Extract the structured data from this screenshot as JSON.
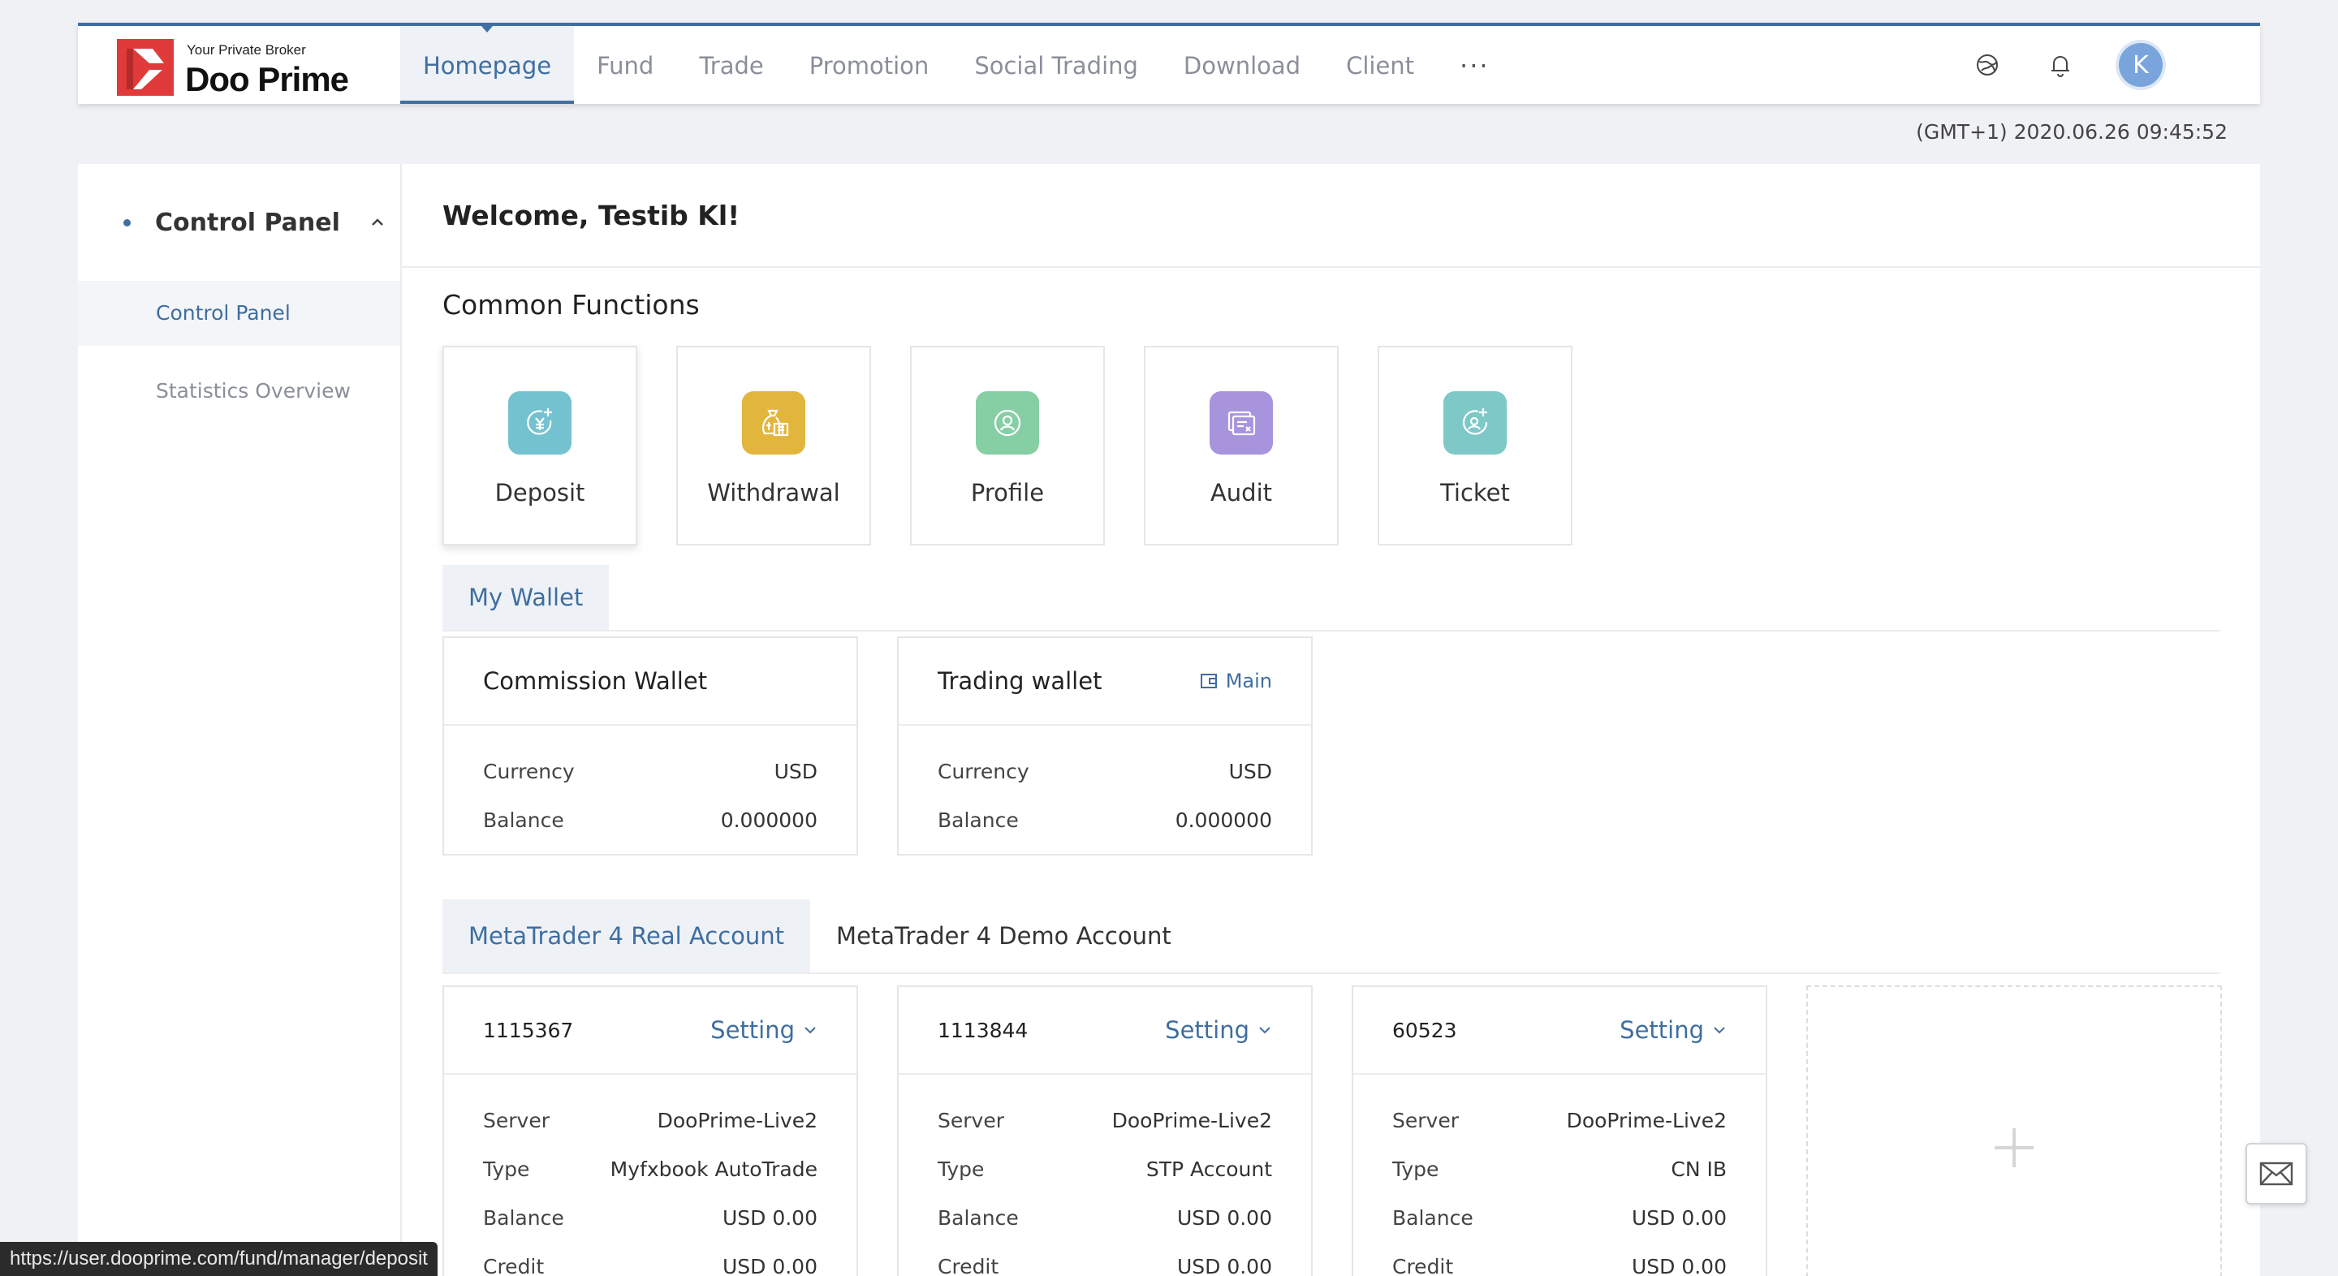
{
  "brand": {
    "tagline": "Your Private Broker",
    "name": "Doo Prime",
    "logo_color": "#e03a3a"
  },
  "nav": {
    "items": [
      {
        "label": "Homepage",
        "active": true
      },
      {
        "label": "Fund"
      },
      {
        "label": "Trade"
      },
      {
        "label": "Promotion"
      },
      {
        "label": "Social Trading"
      },
      {
        "label": "Download"
      },
      {
        "label": "Client"
      }
    ],
    "more_label": "···",
    "icons": [
      "language-icon",
      "bell-icon"
    ],
    "avatar_initial": "K"
  },
  "clock": "(GMT+1) 2020.06.26 09:45:52",
  "sidebar": {
    "group_label": "Control Panel",
    "items": [
      {
        "label": "Control Panel",
        "active": true
      },
      {
        "label": "Statistics Overview"
      }
    ]
  },
  "main": {
    "welcome": "Welcome, Testib Kl!",
    "common_functions_title": "Common Functions",
    "functions": [
      {
        "label": "Deposit",
        "icon": "deposit-icon",
        "color": "#74c2cf"
      },
      {
        "label": "Withdrawal",
        "icon": "withdrawal-icon",
        "color": "#e2b53c"
      },
      {
        "label": "Profile",
        "icon": "profile-icon",
        "color": "#86cfa5"
      },
      {
        "label": "Audit",
        "icon": "audit-icon",
        "color": "#a893dd"
      },
      {
        "label": "Ticket",
        "icon": "ticket-icon",
        "color": "#7ec8c8"
      }
    ],
    "wallet_tab": "My Wallet",
    "wallets": [
      {
        "title": "Commission Wallet",
        "currency_label": "Currency",
        "currency": "USD",
        "balance_label": "Balance",
        "balance": "0.000000"
      },
      {
        "title": "Trading wallet",
        "main_label": "Main",
        "currency_label": "Currency",
        "currency": "USD",
        "balance_label": "Balance",
        "balance": "0.000000"
      }
    ],
    "account_tabs": [
      {
        "label": "MetaTrader 4 Real Account",
        "active": true
      },
      {
        "label": "MetaTrader 4 Demo Account"
      }
    ],
    "accounts": [
      {
        "id": "1115367",
        "setting": "Setting",
        "server": "DooPrime-Live2",
        "type": "Myfxbook AutoTrade",
        "balance": "USD 0.00",
        "credit": "USD 0.00"
      },
      {
        "id": "1113844",
        "setting": "Setting",
        "server": "DooPrime-Live2",
        "type": "STP Account",
        "balance": "USD 0.00",
        "credit": "USD 0.00"
      },
      {
        "id": "60523",
        "setting": "Setting",
        "server": "DooPrime-Live2",
        "type": "CN IB",
        "balance": "USD 0.00",
        "credit": "USD 0.00"
      }
    ],
    "account_labels": {
      "server": "Server",
      "type": "Type",
      "balance": "Balance",
      "credit": "Credit"
    }
  },
  "status_url": "https://user.dooprime.com/fund/manager/deposit",
  "colors": {
    "accent": "#3f6ea0",
    "page_bg": "#f0f1f4"
  }
}
